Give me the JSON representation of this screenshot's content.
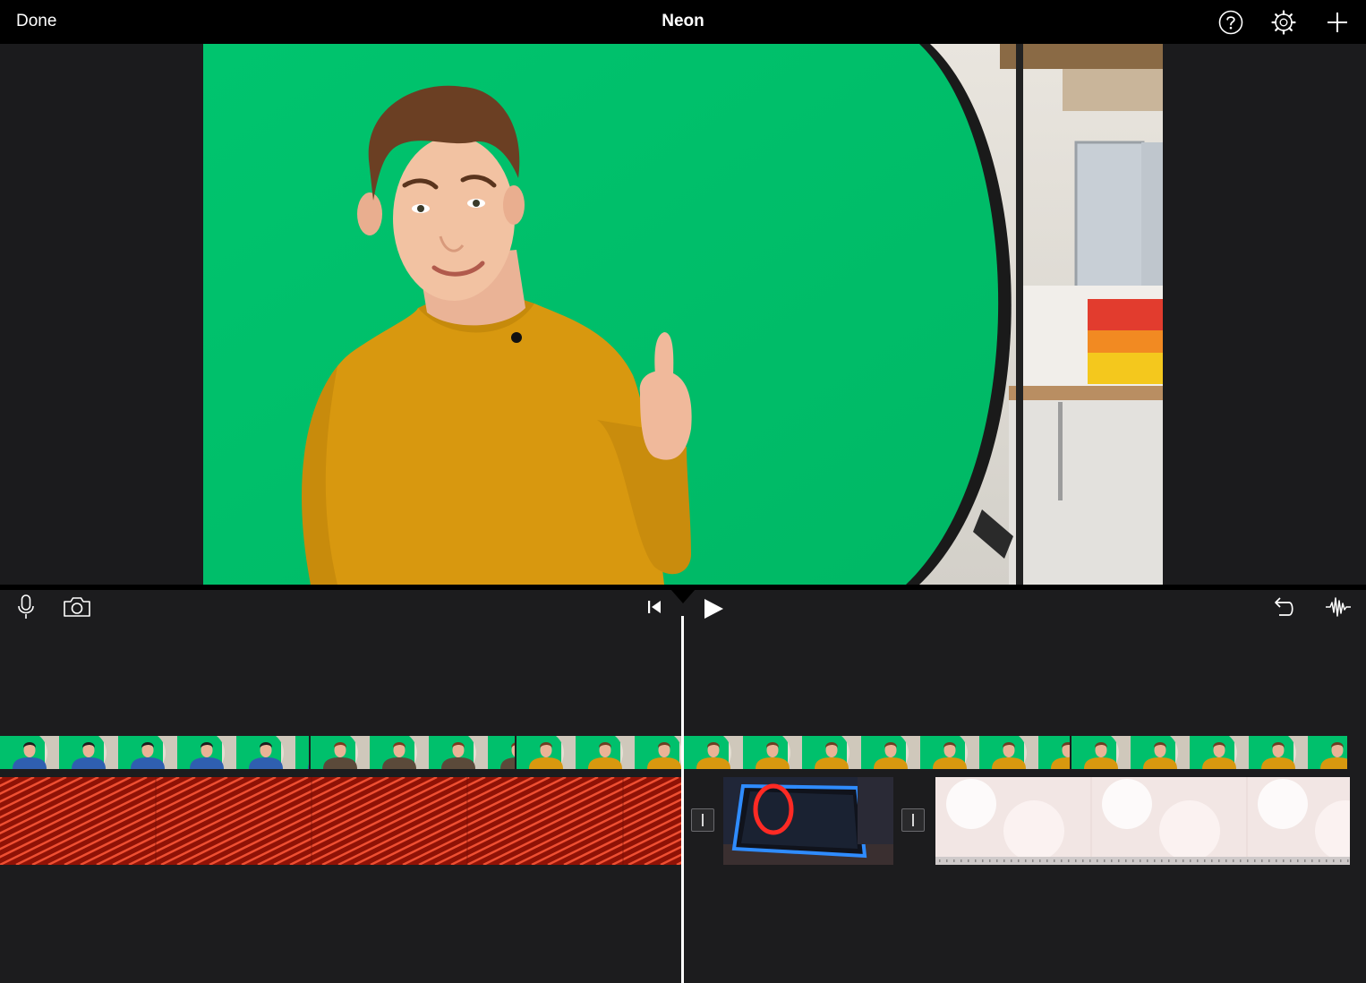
{
  "topbar": {
    "done_label": "Done",
    "title": "Neon",
    "icons": [
      "help-icon",
      "settings-gear-icon",
      "add-plus-icon"
    ]
  },
  "toolbar": {
    "left_icons": [
      "microphone-icon",
      "camera-icon"
    ],
    "center_icons": [
      "skip-to-start-icon",
      "play-icon"
    ],
    "right_icons": [
      "undo-icon",
      "audio-waveform-icon"
    ]
  },
  "colors": {
    "green_screen": "#00c06c",
    "sweater": "#d8980f",
    "neon_red": "#c41f10",
    "neon_blue": "#2f8cff",
    "background": "#1c1c1e"
  }
}
